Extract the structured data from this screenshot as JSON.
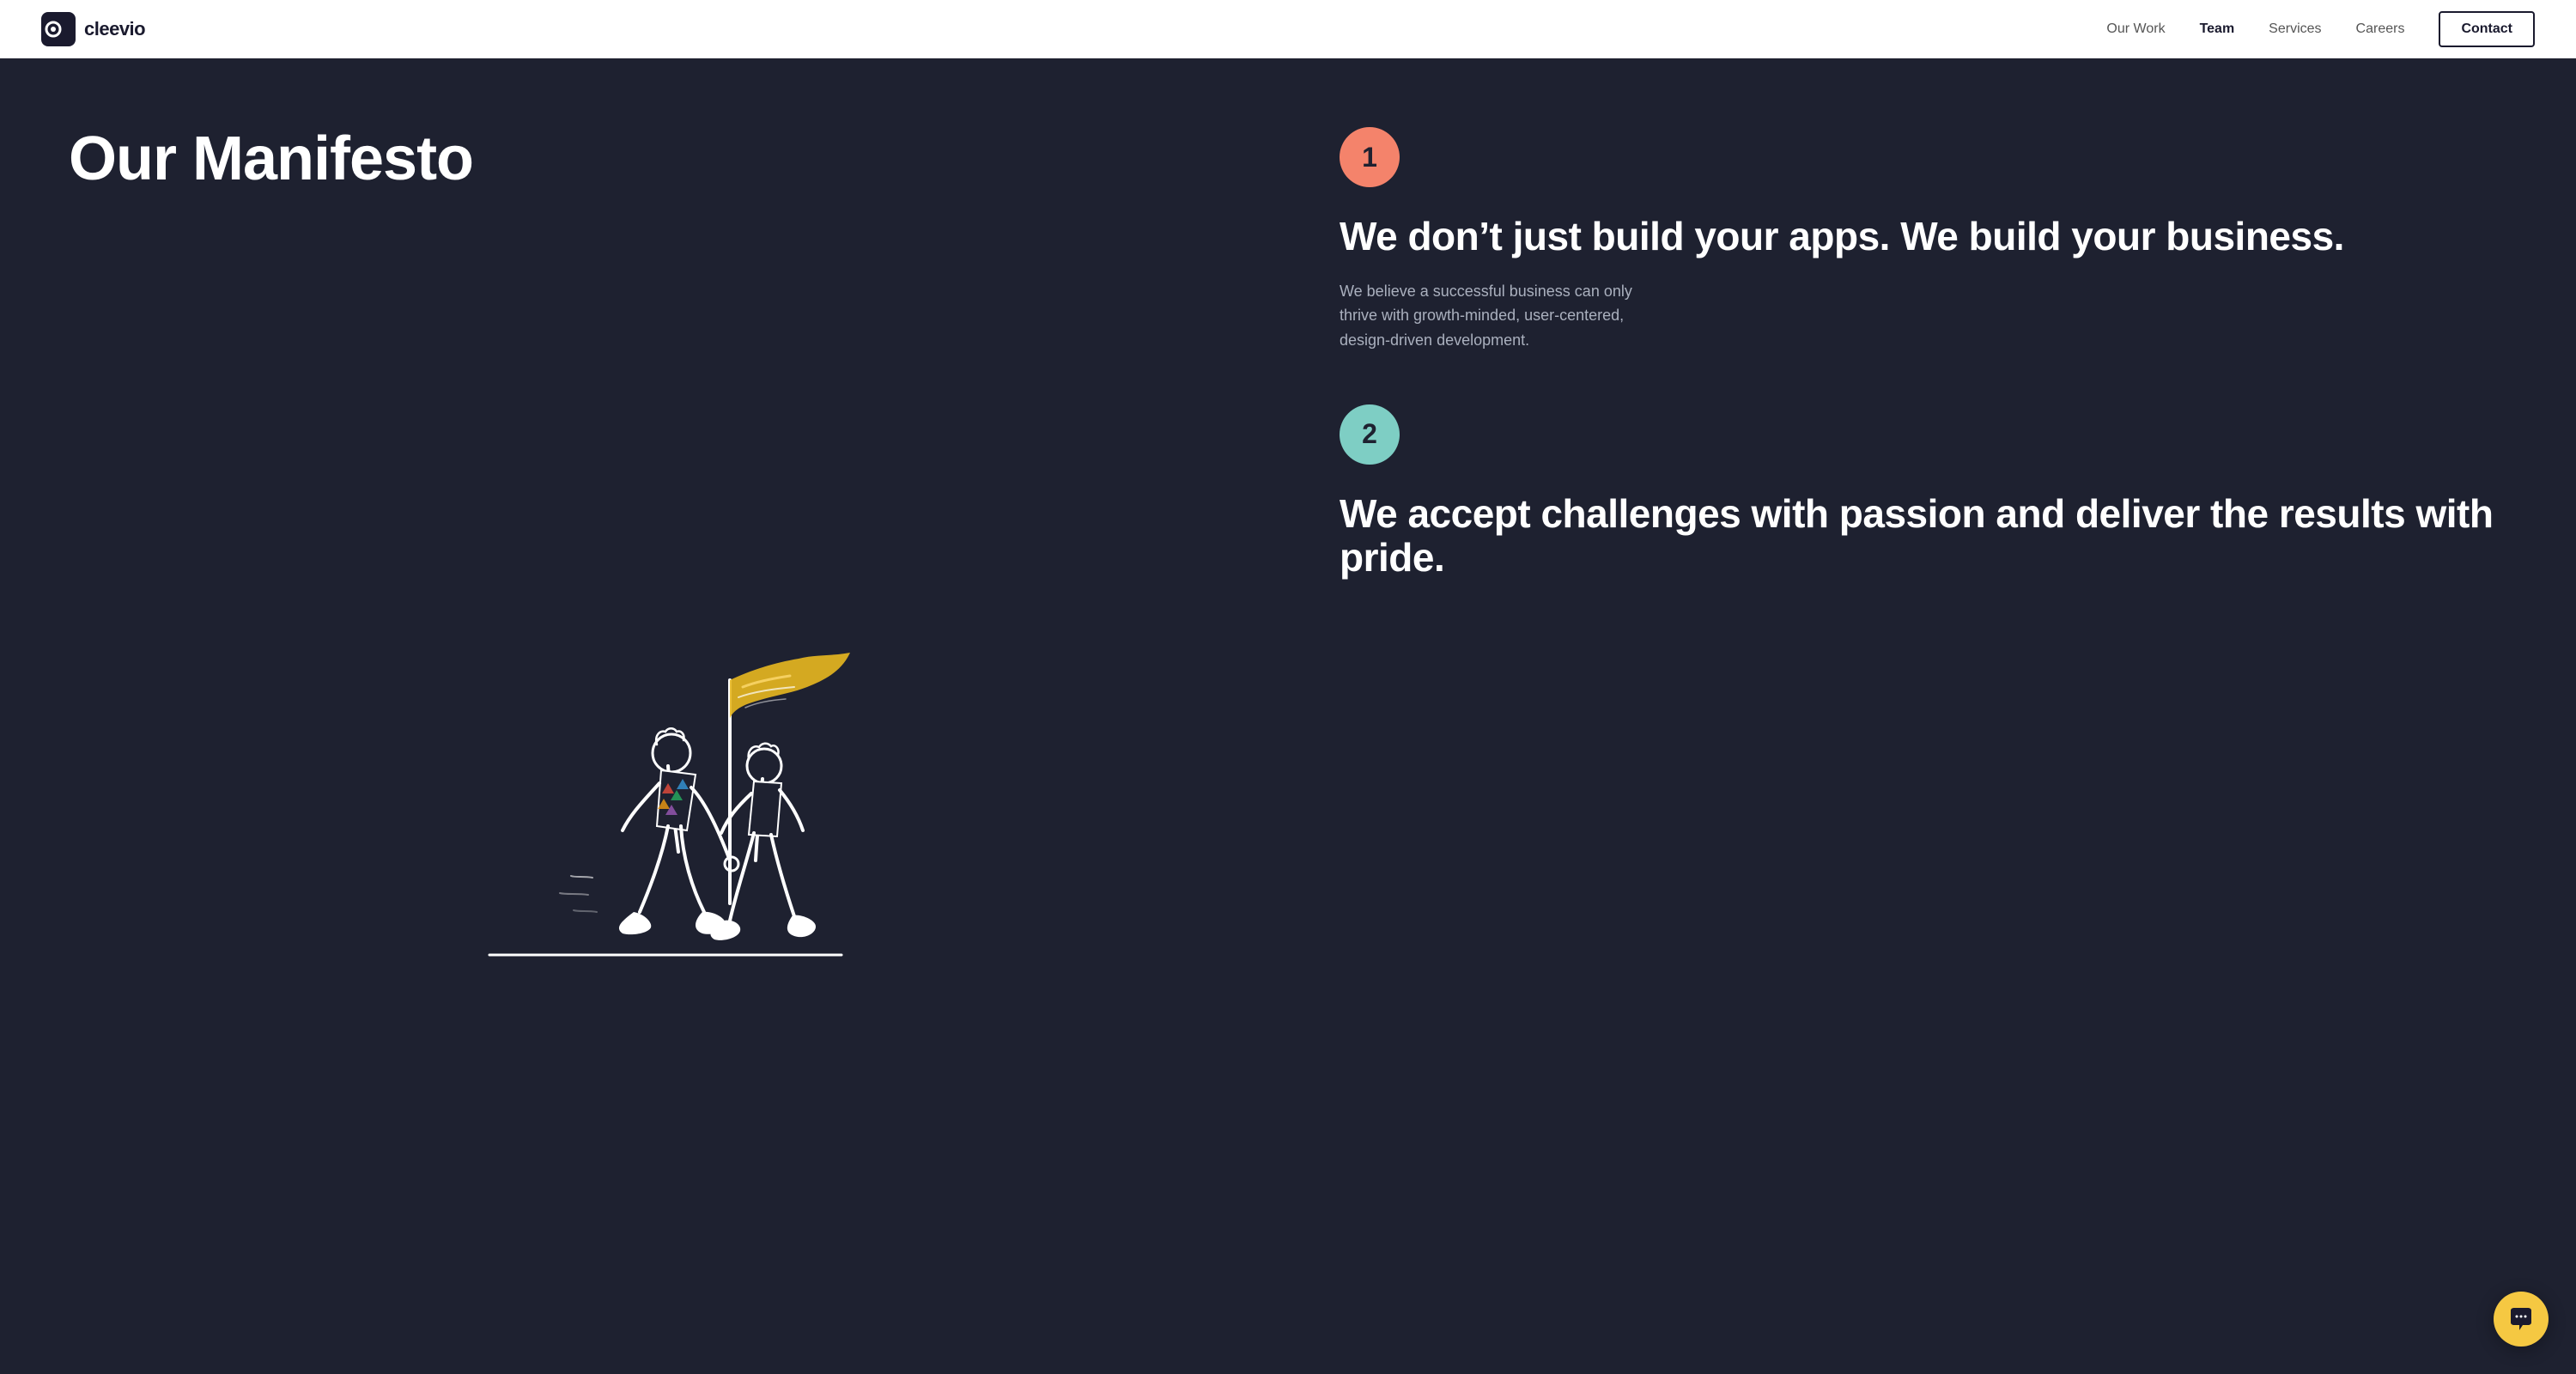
{
  "nav": {
    "logo_text": "cleevio",
    "links": [
      {
        "label": "Our Work",
        "active": false
      },
      {
        "label": "Team",
        "active": true
      },
      {
        "label": "Services",
        "active": false
      },
      {
        "label": "Careers",
        "active": false
      }
    ],
    "contact_btn": "Contact"
  },
  "main": {
    "left": {
      "title": "Our Manifesto"
    },
    "right": {
      "items": [
        {
          "number": "1",
          "badge_color": "salmon",
          "heading": "We don’t just build your apps. We build your business.",
          "description": "We believe a successful business can only thrive with growth-minded, user-centered, design-driven development."
        },
        {
          "number": "2",
          "badge_color": "teal",
          "heading": "We accept challenges with passion and deliver the results with pride.",
          "description": ""
        }
      ]
    }
  }
}
